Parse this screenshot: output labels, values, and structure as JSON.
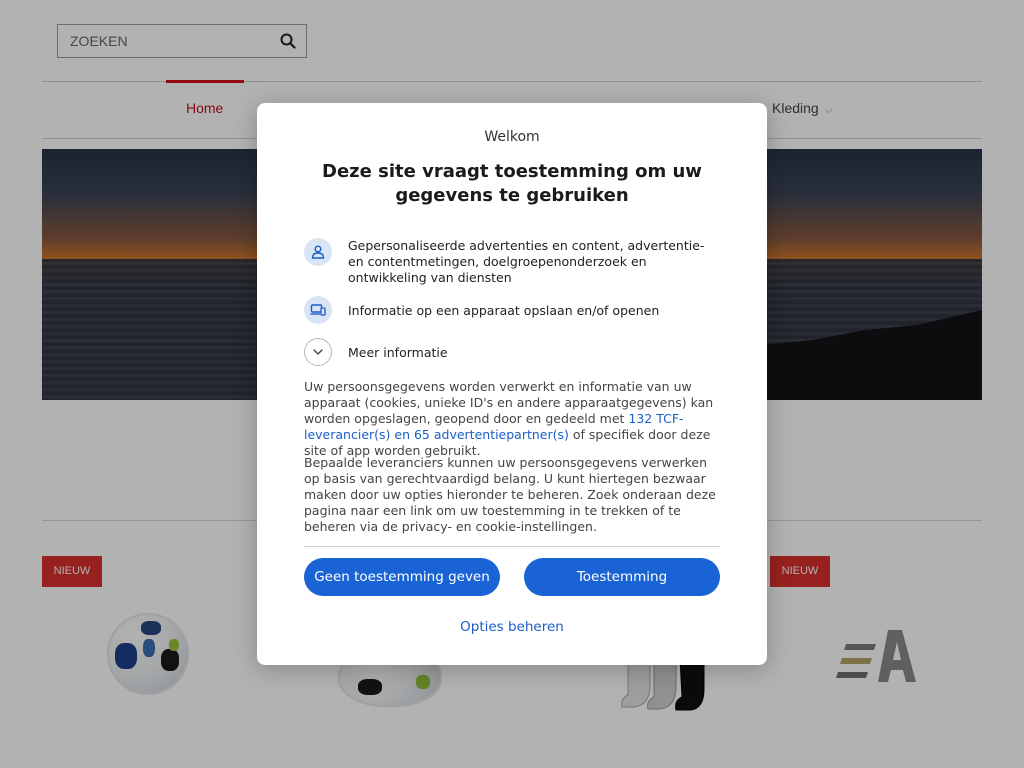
{
  "search": {
    "placeholder": "ZOEKEN"
  },
  "nav": {
    "items": [
      {
        "label": "Home",
        "active": true
      },
      {
        "label": "Kleding",
        "has_dropdown": true
      }
    ]
  },
  "products": {
    "badge_label": "NIEUW"
  },
  "consent": {
    "welcome": "Welkom",
    "title": "Deze site vraagt toestemming om uw gegevens te gebruiken",
    "purposes": [
      {
        "icon": "person-icon",
        "text": "Gepersonaliseerde advertenties en content, advertentie- en contentmetingen, doelgroepenonderzoek en ontwikkeling van diensten"
      },
      {
        "icon": "devices-icon",
        "text": "Informatie op een apparaat opslaan en/of openen"
      },
      {
        "icon": "chevron-down-icon",
        "text": "Meer informatie"
      }
    ],
    "paragraph1": {
      "before": "Uw persoonsgegevens worden verwerkt en informatie van uw apparaat (cookies, unieke ID's en andere apparaatgegevens) kan worden opgeslagen, geopend door en gedeeld met ",
      "link": "132 TCF-leverancier(s) en 65 advertentiepartner(s)",
      "after": " of specifiek door deze site of app worden gebruikt."
    },
    "paragraph2": "Bepaalde leveranciers kunnen uw persoonsgegevens verwerken op basis van gerechtvaardigd belang. U kunt hiertegen bezwaar maken door uw opties hieronder te beheren. Zoek onderaan deze pagina naar een link om uw toestemming in te trekken of te beheren via de privacy- en cookie-instellingen.",
    "buttons": {
      "deny": "Geen toestemming geven",
      "accept": "Toestemming",
      "options": "Opties beheren"
    }
  },
  "colors": {
    "accent_red": "#d0101a",
    "badge_red": "#d8302c",
    "button_blue": "#1a63d5",
    "link_blue": "#1a5fc9"
  }
}
